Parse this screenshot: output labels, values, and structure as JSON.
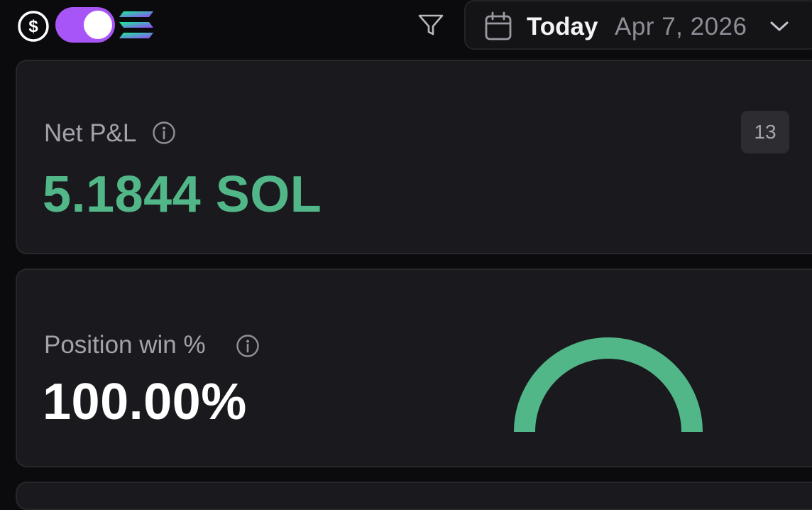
{
  "toolbar": {
    "currency_icon": "dollar-circle-icon",
    "toggle": {
      "state": "on",
      "color": "#a855f7"
    },
    "chain_icon": "solana-icon",
    "filter_icon": "filter-icon",
    "date": {
      "label": "Today",
      "value": "Apr 7, 2026",
      "icon": "calendar-icon",
      "dropdown_icon": "chevron-down-icon"
    }
  },
  "pnl_card": {
    "label": "Net P&L",
    "value": "5.1844 SOL",
    "badge": "13",
    "value_color": "#52b788"
  },
  "win_card": {
    "label": "Position win %",
    "value": "100.00%",
    "gauge_fraction": 1.0,
    "gauge_color": "#52b788"
  }
}
